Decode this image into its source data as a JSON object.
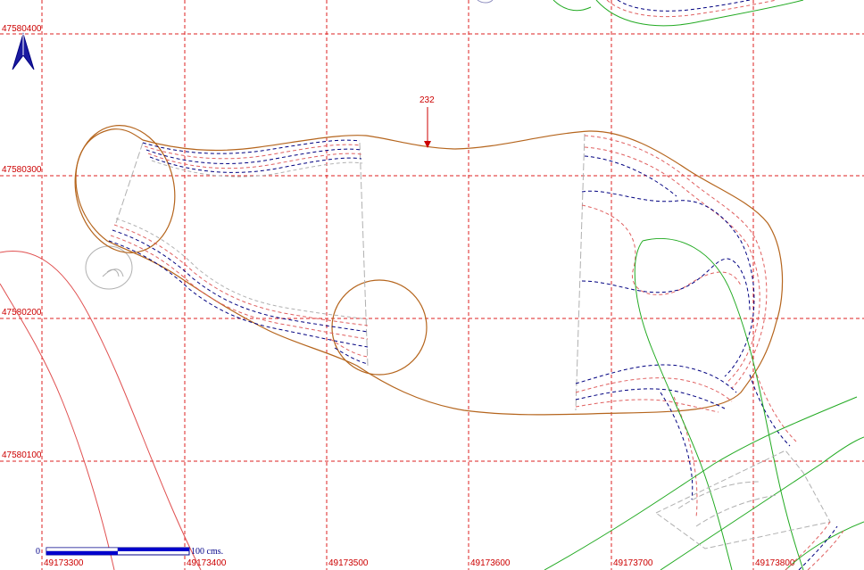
{
  "map": {
    "grid": {
      "northings": [
        "47580400",
        "47580300",
        "47580200",
        "47580100"
      ],
      "eastings": [
        "49173300",
        "49173400",
        "49173500",
        "49173600",
        "49173700",
        "49173800"
      ]
    },
    "feature_label": "232",
    "scale_bar": {
      "start": "0",
      "end": "100 cms."
    },
    "north_arrow": "north-arrow-icon",
    "colors": {
      "grid": "#dd2222",
      "boundary": "#b5651d",
      "contour_red": "#e06060",
      "contour_blue": "#000080",
      "green": "#22aa22",
      "gray": "#b0b0b0",
      "red": "#e05050"
    }
  }
}
